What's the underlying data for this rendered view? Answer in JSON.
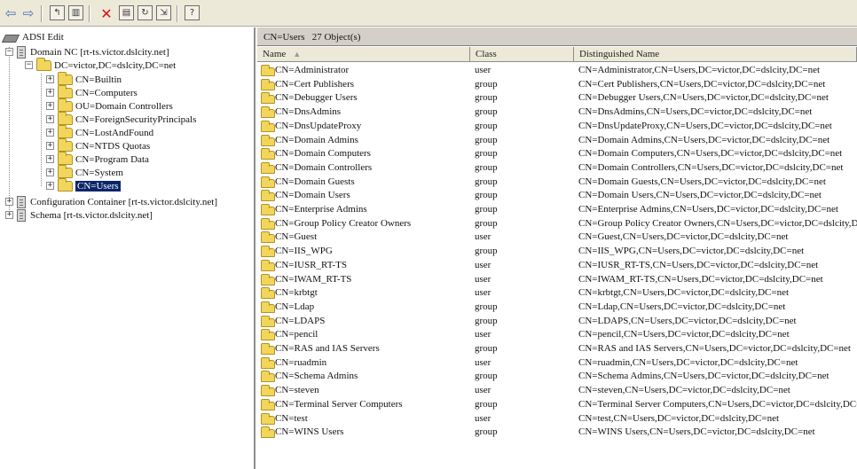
{
  "toolbar": {
    "buttons": [
      "back-arrow",
      "forward-arrow",
      "up-folder",
      "show-hide-tree",
      "delete",
      "properties",
      "refresh",
      "export-list",
      "help"
    ]
  },
  "tree": {
    "root": "ADSI Edit",
    "domain_nc": "Domain NC [rt-ts.victor.dslcity.net]",
    "dc": "DC=victor,DC=dslcity,DC=net",
    "children": [
      "CN=Builtin",
      "CN=Computers",
      "OU=Domain Controllers",
      "CN=ForeignSecurityPrincipals",
      "CN=LostAndFound",
      "CN=NTDS Quotas",
      "CN=Program Data",
      "CN=System",
      "CN=Users"
    ],
    "config": "Configuration Container [rt-ts.victor.dslcity.net]",
    "schema": "Schema [rt-ts.victor.dslcity.net]"
  },
  "details": {
    "title": "CN=Users",
    "count": "27 Object(s)",
    "columns": [
      "Name",
      "Class",
      "Distinguished Name"
    ],
    "rows": [
      {
        "name": "CN=Administrator",
        "class": "user",
        "dn": "CN=Administrator,CN=Users,DC=victor,DC=dslcity,DC=net"
      },
      {
        "name": "CN=Cert Publishers",
        "class": "group",
        "dn": "CN=Cert Publishers,CN=Users,DC=victor,DC=dslcity,DC=net"
      },
      {
        "name": "CN=Debugger Users",
        "class": "group",
        "dn": "CN=Debugger Users,CN=Users,DC=victor,DC=dslcity,DC=net"
      },
      {
        "name": "CN=DnsAdmins",
        "class": "group",
        "dn": "CN=DnsAdmins,CN=Users,DC=victor,DC=dslcity,DC=net"
      },
      {
        "name": "CN=DnsUpdateProxy",
        "class": "group",
        "dn": "CN=DnsUpdateProxy,CN=Users,DC=victor,DC=dslcity,DC=net"
      },
      {
        "name": "CN=Domain Admins",
        "class": "group",
        "dn": "CN=Domain Admins,CN=Users,DC=victor,DC=dslcity,DC=net"
      },
      {
        "name": "CN=Domain Computers",
        "class": "group",
        "dn": "CN=Domain Computers,CN=Users,DC=victor,DC=dslcity,DC=net"
      },
      {
        "name": "CN=Domain Controllers",
        "class": "group",
        "dn": "CN=Domain Controllers,CN=Users,DC=victor,DC=dslcity,DC=net"
      },
      {
        "name": "CN=Domain Guests",
        "class": "group",
        "dn": "CN=Domain Guests,CN=Users,DC=victor,DC=dslcity,DC=net"
      },
      {
        "name": "CN=Domain Users",
        "class": "group",
        "dn": "CN=Domain Users,CN=Users,DC=victor,DC=dslcity,DC=net"
      },
      {
        "name": "CN=Enterprise Admins",
        "class": "group",
        "dn": "CN=Enterprise Admins,CN=Users,DC=victor,DC=dslcity,DC=net"
      },
      {
        "name": "CN=Group Policy Creator Owners",
        "class": "group",
        "dn": "CN=Group Policy Creator Owners,CN=Users,DC=victor,DC=dslcity,DC"
      },
      {
        "name": "CN=Guest",
        "class": "user",
        "dn": "CN=Guest,CN=Users,DC=victor,DC=dslcity,DC=net"
      },
      {
        "name": "CN=IIS_WPG",
        "class": "group",
        "dn": "CN=IIS_WPG,CN=Users,DC=victor,DC=dslcity,DC=net"
      },
      {
        "name": "CN=IUSR_RT-TS",
        "class": "user",
        "dn": "CN=IUSR_RT-TS,CN=Users,DC=victor,DC=dslcity,DC=net"
      },
      {
        "name": "CN=IWAM_RT-TS",
        "class": "user",
        "dn": "CN=IWAM_RT-TS,CN=Users,DC=victor,DC=dslcity,DC=net"
      },
      {
        "name": "CN=krbtgt",
        "class": "user",
        "dn": "CN=krbtgt,CN=Users,DC=victor,DC=dslcity,DC=net"
      },
      {
        "name": "CN=Ldap",
        "class": "group",
        "dn": "CN=Ldap,CN=Users,DC=victor,DC=dslcity,DC=net"
      },
      {
        "name": "CN=LDAPS",
        "class": "group",
        "dn": "CN=LDAPS,CN=Users,DC=victor,DC=dslcity,DC=net"
      },
      {
        "name": "CN=pencil",
        "class": "user",
        "dn": "CN=pencil,CN=Users,DC=victor,DC=dslcity,DC=net"
      },
      {
        "name": "CN=RAS and IAS Servers",
        "class": "group",
        "dn": "CN=RAS and IAS Servers,CN=Users,DC=victor,DC=dslcity,DC=net"
      },
      {
        "name": "CN=ruadmin",
        "class": "user",
        "dn": "CN=ruadmin,CN=Users,DC=victor,DC=dslcity,DC=net"
      },
      {
        "name": "CN=Schema Admins",
        "class": "group",
        "dn": "CN=Schema Admins,CN=Users,DC=victor,DC=dslcity,DC=net"
      },
      {
        "name": "CN=steven",
        "class": "user",
        "dn": "CN=steven,CN=Users,DC=victor,DC=dslcity,DC=net"
      },
      {
        "name": "CN=Terminal Server Computers",
        "class": "group",
        "dn": "CN=Terminal Server Computers,CN=Users,DC=victor,DC=dslcity,DC=ne"
      },
      {
        "name": "CN=test",
        "class": "user",
        "dn": "CN=test,CN=Users,DC=victor,DC=dslcity,DC=net"
      },
      {
        "name": "CN=WINS Users",
        "class": "group",
        "dn": "CN=WINS Users,CN=Users,DC=victor,DC=dslcity,DC=net"
      }
    ]
  }
}
